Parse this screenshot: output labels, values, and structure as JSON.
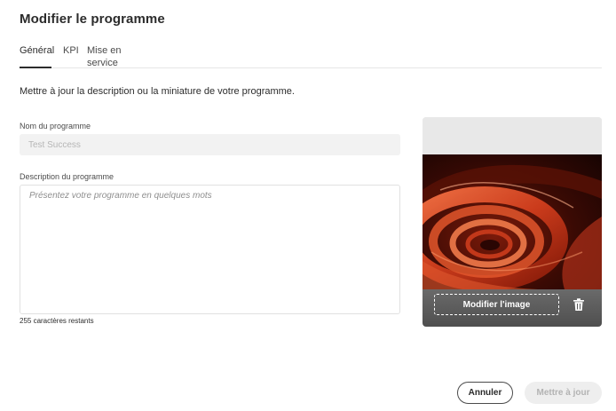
{
  "dialog": {
    "title": "Modifier le programme"
  },
  "tabs": [
    {
      "label": "Général",
      "selected": true
    },
    {
      "label": "KPI",
      "selected": false
    },
    {
      "label": "Mise en service",
      "selected": false
    }
  ],
  "intro": "Mettre à jour la description ou la miniature de votre programme.",
  "form": {
    "name_label": "Nom du programme",
    "name_value": "Test Success",
    "description_label": "Description du programme",
    "description_placeholder": "Présentez votre programme en quelques mots",
    "description_value": "",
    "counter": "255 caractères restants"
  },
  "thumbnail": {
    "modify_label": "Modifier l'image",
    "delete_icon": "trash-icon"
  },
  "footer": {
    "cancel_label": "Annuler",
    "update_label": "Mettre à jour",
    "update_enabled": false
  }
}
